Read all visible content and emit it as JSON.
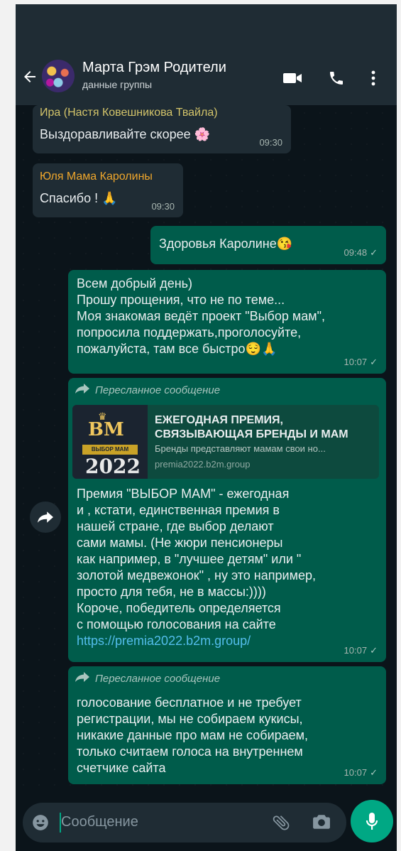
{
  "header": {
    "title": "Марта Грэм Родители",
    "subtitle": "данные группы",
    "icons": [
      "back-arrow-icon",
      "video-call-icon",
      "phone-icon",
      "more-vertical-icon"
    ]
  },
  "messages": [
    {
      "type": "incoming",
      "sender": "Ира (Настя Ковешникова Твайла)",
      "sender_color": "#d3c46a",
      "text": "Выздоравливайте скорее 🌸",
      "time": "09:30"
    },
    {
      "type": "incoming",
      "sender": "Юля Мама Каролины",
      "sender_color": "#f0a72c",
      "text": "Спасибо ! 🙏",
      "time": "09:30"
    },
    {
      "type": "outgoing",
      "text": "Здоровья Каролине😘",
      "time": "09:48",
      "ticks": "✓"
    },
    {
      "type": "outgoing",
      "text": "Всем добрый день)\nПрошу прощения, что не по теме...\nМоя знакомая ведёт проект \"Выбор мам\",\nпопросила поддержать,проголосуйте,\nпожалуйста, там все быстро😌🙏",
      "time": "10:07",
      "ticks": "✓"
    },
    {
      "type": "outgoing",
      "forwarded_label": "Пересланное сообщение",
      "link_preview": {
        "title": "ЕЖЕГОДНАЯ ПРЕМИЯ,\nСВЯЗЫВАЮЩАЯ БРЕНДЫ И МАМ",
        "description": "Бренды представляют мамам свои но...",
        "domain": "premia2022.b2m.group",
        "image_text": {
          "logo": "BM",
          "ribbon": "ВЫБОР МАМ",
          "year": "2022"
        }
      },
      "text": "Премия \"ВЫБОР МАМ\" - ежегодная\nи , кстати, единственная премия в\nнашей стране, где выбор делают\nсами мамы. (Не жюри пенсионеры\nкак например, в \"лучшее детям\" или \"\nзолотой медвежонок\" , ну это например,\nпросто для тебя, не в массы:))))\nКороче, победитель определяется\nс помощью голосования на сайте",
      "link": "https://premia2022.b2m.group/",
      "time": "10:07",
      "ticks": "✓"
    },
    {
      "type": "outgoing",
      "forwarded_label": "Пересланное сообщение",
      "text": "голосование бесплатное и не требует\nрегистрации, мы не собираем кукисы,\nникакие данные про мам не собираем,\nтолько считаем голоса на внутреннем\nсчетчике сайта",
      "time": "10:07",
      "ticks": "✓"
    }
  ],
  "composer": {
    "placeholder": "Сообщение",
    "icons": [
      "emoji-icon",
      "attach-icon",
      "camera-icon",
      "mic-icon"
    ]
  },
  "colors": {
    "header_bg": "#1f2c34",
    "incoming_bubble": "#1f2c34",
    "outgoing_bubble": "#005c4b",
    "accent": "#00a884",
    "link": "#53bdeb"
  }
}
